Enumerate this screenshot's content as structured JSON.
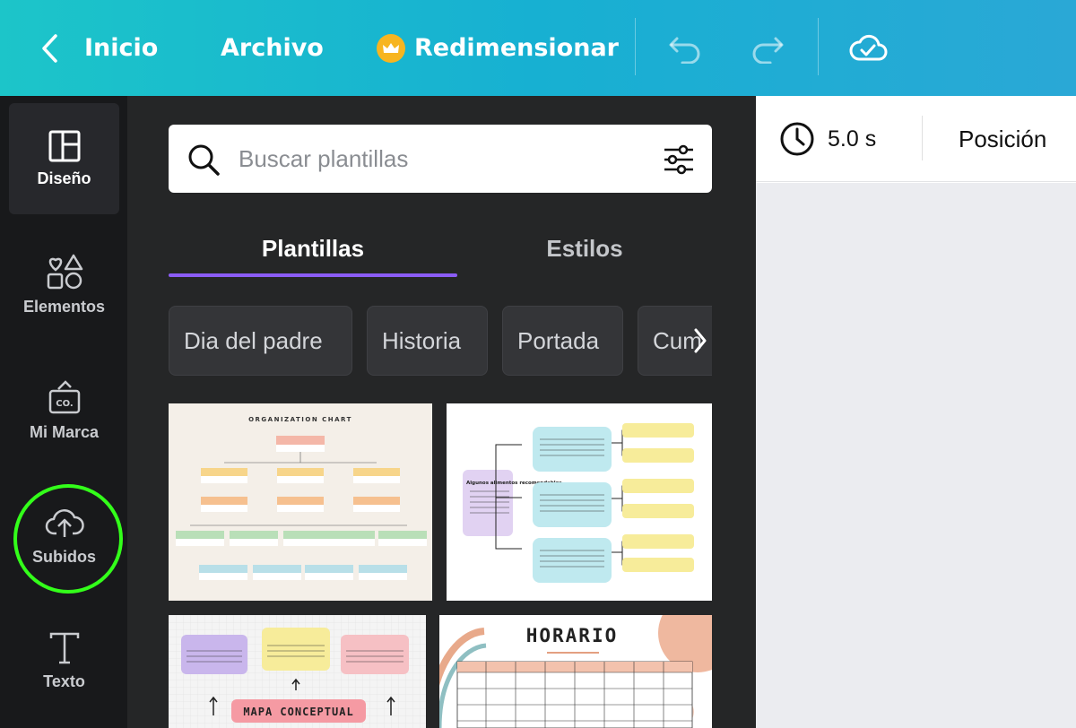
{
  "topbar": {
    "back_label": "Inicio",
    "file_label": "Archivo",
    "resize_label": "Redimensionar"
  },
  "rail": {
    "items": [
      {
        "label": "Diseño",
        "icon": "layout-icon"
      },
      {
        "label": "Elementos",
        "icon": "shapes-icon"
      },
      {
        "label": "Mi Marca",
        "icon": "brand-icon"
      },
      {
        "label": "Subidos",
        "icon": "cloud-upload-icon"
      },
      {
        "label": "Texto",
        "icon": "text-icon"
      }
    ]
  },
  "panel": {
    "search_placeholder": "Buscar plantillas",
    "tabs": [
      {
        "label": "Plantillas"
      },
      {
        "label": "Estilos"
      }
    ],
    "chips": [
      {
        "label": "Dia del padre"
      },
      {
        "label": "Historia"
      },
      {
        "label": "Portada"
      },
      {
        "label": "Cum"
      }
    ],
    "templates": [
      {
        "title": "ORGANIZATION CHART"
      },
      {
        "title": "Algunos alimentos recomendables"
      },
      {
        "title": "MAPA CONCEPTUAL"
      },
      {
        "title": "HORARIO"
      }
    ]
  },
  "toolbar": {
    "duration": "5.0 s",
    "position_label": "Posición"
  },
  "colors": {
    "topbar_start": "#1cc5c9",
    "topbar_end": "#2aa8d6",
    "rail_bg": "#18191b",
    "panel_bg": "#252627",
    "tab_accent": "#8b5cf6",
    "highlight": "#33ff1a",
    "crown": "#f7b520"
  }
}
